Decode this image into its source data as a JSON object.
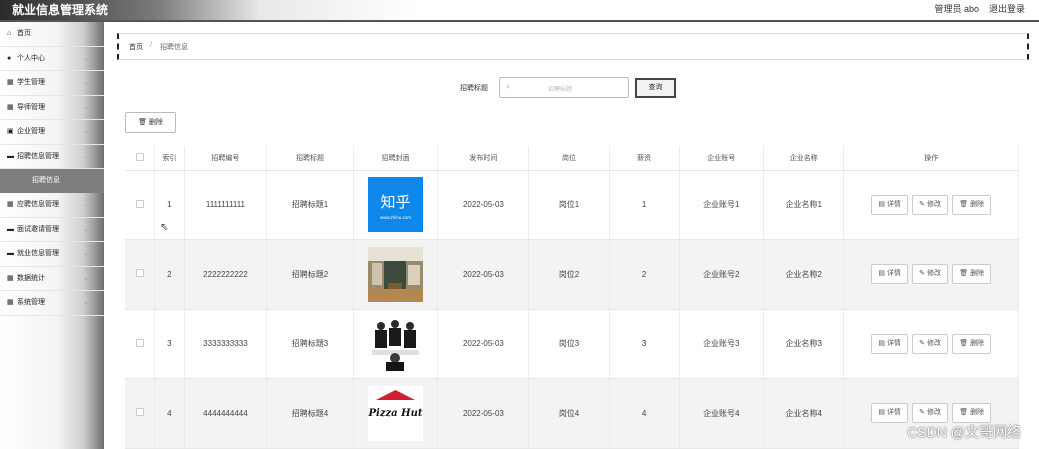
{
  "header": {
    "app_title": "就业信息管理系统",
    "user": "管理员 abo",
    "logout": "退出登录"
  },
  "sidebar": {
    "items": [
      {
        "icon": "home-icon",
        "label": "首页",
        "chev": ""
      },
      {
        "icon": "person-icon",
        "label": "个人中心",
        "chev": "⌄"
      },
      {
        "icon": "grid-icon",
        "label": "学生管理",
        "chev": "⌄"
      },
      {
        "icon": "grid-icon",
        "label": "导师管理",
        "chev": "⌄"
      },
      {
        "icon": "building-icon",
        "label": "企业管理",
        "chev": "⌄"
      },
      {
        "icon": "document-icon",
        "label": "招聘信息管理",
        "chev": "⌄"
      }
    ],
    "sub_item": "招聘信息",
    "items_after": [
      {
        "icon": "grid-icon",
        "label": "应聘信息管理",
        "chev": "⌄"
      },
      {
        "icon": "document-icon",
        "label": "面试邀请管理",
        "chev": "⌄"
      },
      {
        "icon": "document-icon",
        "label": "就业信息管理",
        "chev": "⌄"
      },
      {
        "icon": "grid-icon",
        "label": "数据统计",
        "chev": "⌄"
      },
      {
        "icon": "grid-icon",
        "label": "系统管理",
        "chev": "⌄"
      }
    ]
  },
  "breadcrumb": {
    "home": "首页",
    "sep": "/",
    "current": "招聘信息"
  },
  "search": {
    "label": "招聘标题",
    "placeholder": "招聘标题",
    "button": "查询"
  },
  "toolbar": {
    "delete": "删除"
  },
  "table": {
    "columns": [
      "",
      "索引",
      "招聘编号",
      "招聘标题",
      "招聘封面",
      "发布时间",
      "岗位",
      "薪资",
      "企业账号",
      "企业名称",
      "操作"
    ],
    "rows": [
      {
        "index": "1",
        "code": "1111111111",
        "title": "招聘标题1",
        "cover": "zhihu",
        "cover_text": "知乎",
        "cover_sub": "www.zhihu.com",
        "date": "2022-05-03",
        "post": "岗位1",
        "salary": "1",
        "account": "企业账号1",
        "company": "企业名称1"
      },
      {
        "index": "2",
        "code": "2222222222",
        "title": "招聘标题2",
        "cover": "office",
        "date": "2022-05-03",
        "post": "岗位2",
        "salary": "2",
        "account": "企业账号2",
        "company": "企业名称2"
      },
      {
        "index": "3",
        "code": "3333333333",
        "title": "招聘标题3",
        "cover": "meeting",
        "date": "2022-05-03",
        "post": "岗位3",
        "salary": "3",
        "account": "企业账号3",
        "company": "企业名称3"
      },
      {
        "index": "4",
        "code": "4444444444",
        "title": "招聘标题4",
        "cover": "pizza",
        "cover_text": "Pizza Hut",
        "date": "2022-05-03",
        "post": "岗位4",
        "salary": "4",
        "account": "企业账号4",
        "company": "企业名称4"
      }
    ],
    "actions": {
      "detail": "详情",
      "edit": "修改",
      "delete": "删除"
    }
  },
  "watermark": "CSDN @文哥网络",
  "colors": {
    "zhihu_blue": "#0f88eb",
    "pizza_red": "#d0202e",
    "sidebar_active": "#7d7d7d"
  }
}
